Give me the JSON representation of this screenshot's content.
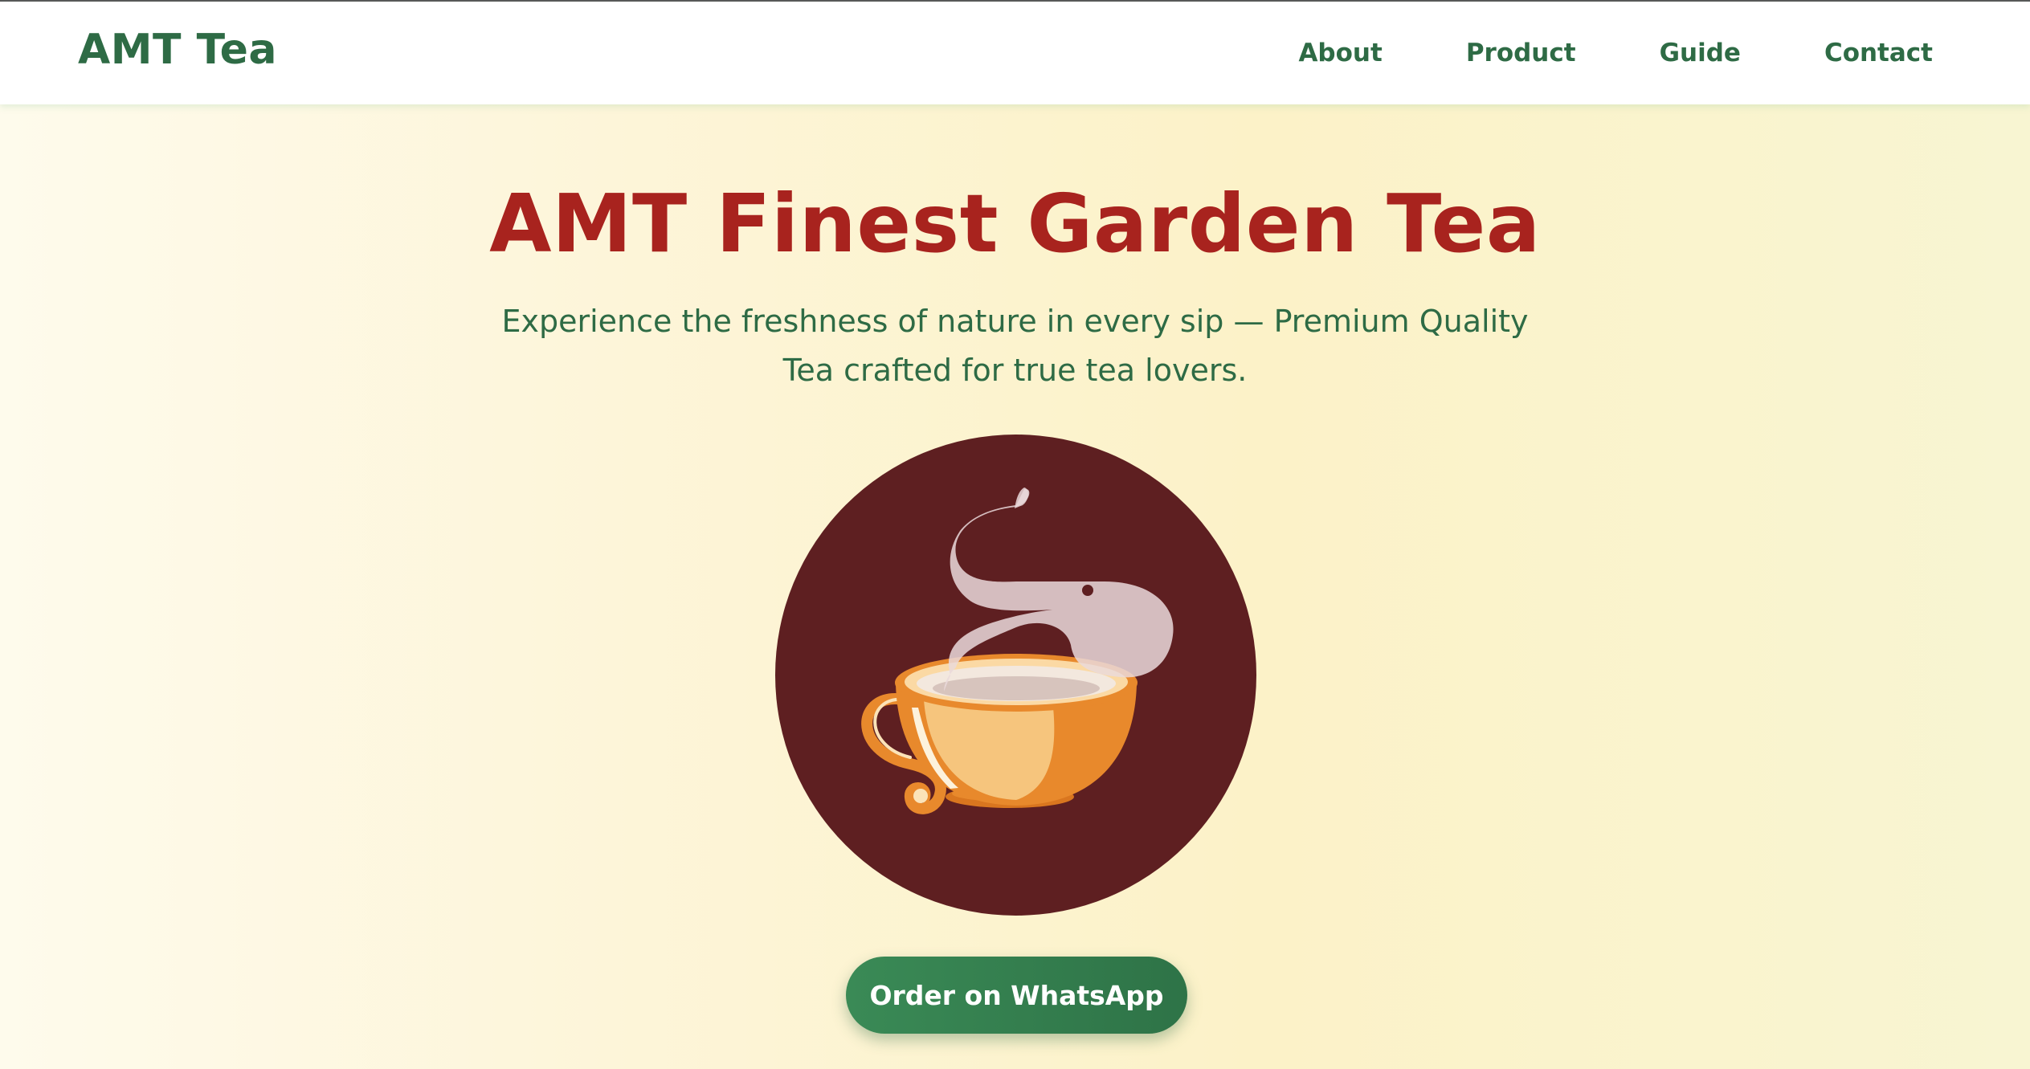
{
  "header": {
    "brand": "AMT Tea",
    "nav": [
      {
        "label": "About"
      },
      {
        "label": "Product"
      },
      {
        "label": "Guide"
      },
      {
        "label": "Contact"
      }
    ]
  },
  "hero": {
    "title": "AMT Finest Garden Tea",
    "subtitle": "Experience the freshness of nature in every sip — Premium Quality Tea crafted for true tea lovers.",
    "image_icon": "steaming-tea-cup",
    "cta_label": "Order on WhatsApp"
  },
  "colors": {
    "brand_green": "#2e6b45",
    "title_red": "#a8231e",
    "circle_maroon": "#5e1f21",
    "cup_orange": "#e8892c",
    "button_green": "#3a8a56"
  }
}
